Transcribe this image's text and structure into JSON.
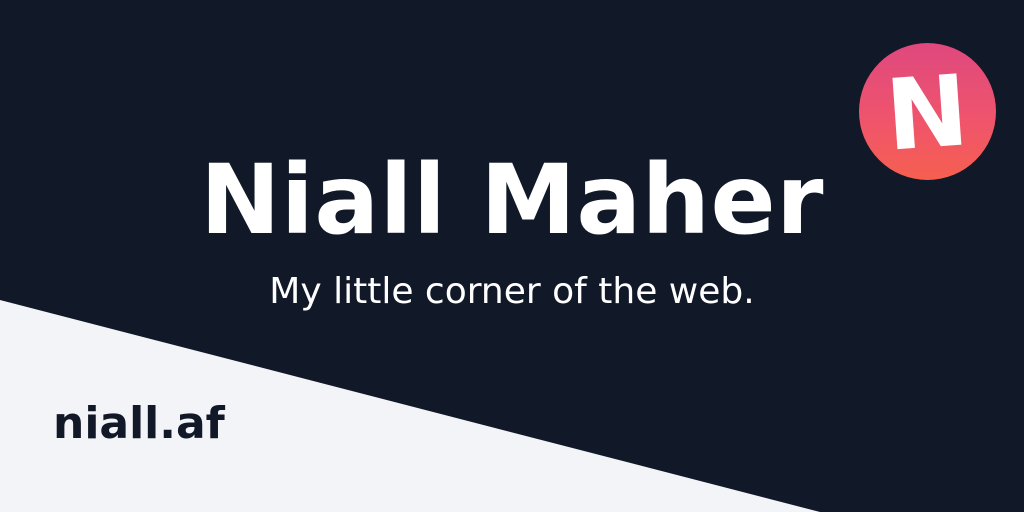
{
  "header": {
    "title": "Niall Maher",
    "tagline": "My little corner of the web."
  },
  "logo": {
    "letter": "N",
    "icon": "n-logo-icon"
  },
  "footer": {
    "domain": "niall.af"
  },
  "colors": {
    "background": "#111827",
    "light_panel": "#f3f4f8",
    "logo_gradient_top": "#df487f",
    "logo_gradient_bottom": "#f65f4f",
    "text_light": "#ffffff",
    "text_dark": "#111827"
  }
}
